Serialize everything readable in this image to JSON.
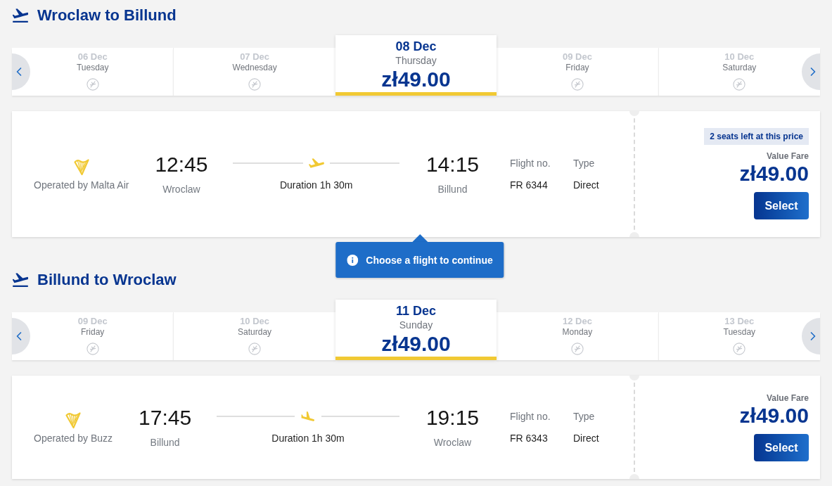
{
  "sections": [
    {
      "kind": "outbound",
      "title": "Wroclaw to Billund",
      "dates": [
        {
          "date": "06 Dec",
          "day": "Tuesday",
          "selected": false
        },
        {
          "date": "07 Dec",
          "day": "Wednesday",
          "selected": false
        },
        {
          "date": "08 Dec",
          "day": "Thursday",
          "price": "zł49.00",
          "selected": true
        },
        {
          "date": "09 Dec",
          "day": "Friday",
          "selected": false
        },
        {
          "date": "10 Dec",
          "day": "Saturday",
          "selected": false
        }
      ],
      "flight": {
        "operator": "Operated by Malta Air",
        "departure_time": "12:45",
        "departure_city": "Wroclaw",
        "duration": "Duration 1h 30m",
        "arrival_time": "14:15",
        "arrival_city": "Billund",
        "flight_no_label": "Flight no.",
        "flight_no": "FR 6344",
        "type_label": "Type",
        "type": "Direct",
        "badge": "2 seats left at this price",
        "fare": "Value Fare",
        "price": "zł49.00",
        "button": "Select"
      }
    },
    {
      "kind": "return",
      "title": "Billund to Wroclaw",
      "dates": [
        {
          "date": "09 Dec",
          "day": "Friday",
          "selected": false
        },
        {
          "date": "10 Dec",
          "day": "Saturday",
          "selected": false
        },
        {
          "date": "11 Dec",
          "day": "Sunday",
          "price": "zł49.00",
          "selected": true
        },
        {
          "date": "12 Dec",
          "day": "Monday",
          "selected": false
        },
        {
          "date": "13 Dec",
          "day": "Tuesday",
          "selected": false
        }
      ],
      "flight": {
        "operator": "Operated by Buzz",
        "departure_time": "17:45",
        "departure_city": "Billund",
        "duration": "Duration 1h 30m",
        "arrival_time": "19:15",
        "arrival_city": "Wroclaw",
        "flight_no_label": "Flight no.",
        "flight_no": "FR 6343",
        "type_label": "Type",
        "type": "Direct",
        "fare": "Value Fare",
        "price": "zł49.00",
        "button": "Select"
      }
    }
  ],
  "tooltip": {
    "text": "Choose a flight to continue"
  }
}
